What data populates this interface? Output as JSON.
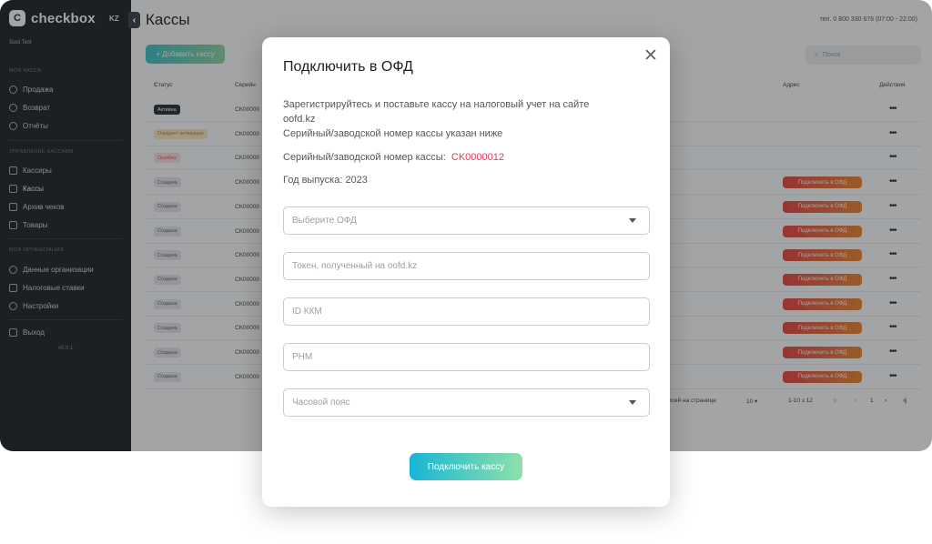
{
  "brand": {
    "logo": "C",
    "name": "checkbox",
    "lang": "KZ",
    "user": "Sust Test"
  },
  "sidebar": {
    "sections": [
      {
        "title": "МОЯ КАССА",
        "items": [
          {
            "label": "Продажа",
            "icon": "cart-icon"
          },
          {
            "label": "Возврат",
            "icon": "return-icon"
          },
          {
            "label": "Отчёты",
            "icon": "report-icon"
          }
        ]
      },
      {
        "title": "УПРАВЛЕНИЕ КАССАМИ",
        "items": [
          {
            "label": "Кассиры",
            "icon": "people-icon"
          },
          {
            "label": "Кассы",
            "icon": "register-icon"
          },
          {
            "label": "Архив чеков",
            "icon": "archive-icon"
          },
          {
            "label": "Товары",
            "icon": "box-icon"
          }
        ]
      },
      {
        "title": "МОЯ ОРГАНИЗАЦИЯ",
        "items": [
          {
            "label": "Данные организации",
            "icon": "org-icon"
          },
          {
            "label": "Налоговые ставки",
            "icon": "tax-icon"
          },
          {
            "label": "Настройки",
            "icon": "gear-icon"
          }
        ]
      }
    ],
    "logout": "Выход",
    "version": "v0.0.1"
  },
  "main": {
    "title": "Кассы",
    "phone": "тел. 0 800 330 676 (07:00 - 22:00)",
    "add_button": "+ Добавить кассу",
    "search_placeholder": "Поиск",
    "columns": {
      "status": "Статус",
      "serial": "Серийн",
      "address": "Адрес",
      "actions": "Действия"
    },
    "rows": [
      {
        "status": "Активна",
        "type": "active",
        "serial": "CK00000",
        "ofd": ""
      },
      {
        "status": "Ожидает активации",
        "type": "wait",
        "serial": "CK00000",
        "ofd": ""
      },
      {
        "status": "Ошибка",
        "type": "err",
        "serial": "CK00000",
        "ofd": ""
      },
      {
        "status": "Создана",
        "type": "created",
        "serial": "CK00000",
        "ofd": "Подключить в ОФД"
      },
      {
        "status": "Создана",
        "type": "created",
        "serial": "CK00000",
        "ofd": "Подключить в ОФД"
      },
      {
        "status": "Создана",
        "type": "created",
        "serial": "CK00000",
        "ofd": "Подключить в ОФД"
      },
      {
        "status": "Создана",
        "type": "created",
        "serial": "CK00000",
        "ofd": "Подключить в ОФД"
      },
      {
        "status": "Создана",
        "type": "created",
        "serial": "CK00000",
        "ofd": "Подключить в ОФД"
      },
      {
        "status": "Создана",
        "type": "created",
        "serial": "CK00000",
        "ofd": "Подключить в ОФД"
      },
      {
        "status": "Создана",
        "type": "created",
        "serial": "CK00000",
        "ofd": "Подключить в ОФД"
      },
      {
        "status": "Создана",
        "type": "created",
        "serial": "CK00000",
        "ofd": "Подключить в ОФД"
      },
      {
        "status": "Создана",
        "type": "created",
        "serial": "CK00000",
        "ofd": "Подключить в ОФД"
      }
    ],
    "pagination": {
      "per_page_label": "исей на странице",
      "per_page": "10",
      "range": "1-10 з 12",
      "page": "1"
    }
  },
  "modal": {
    "title": "Подключить в ОФД",
    "line1": "Зарегистрируйтесь и поставьте кассу на налоговый учет на сайте",
    "line2": "oofd.kz",
    "line3": "Серийный/заводской номер кассы указан ниже",
    "serial_label": "Серийный/заводской номер кассы:",
    "serial_value": "CK0000012",
    "year_label": "Год выпуска: 2023",
    "fields": [
      "Выберите ОФД",
      "Токен, полученный на oofd.kz",
      "ID ККМ",
      "РНМ",
      "Часовой пояс"
    ],
    "submit": "Подключить кассу"
  },
  "colors": {
    "sidebar": "#1e2326",
    "accent_teal": "#3fc2c8",
    "ofd_button": "#e94545",
    "serial_red": "#e5385a"
  }
}
